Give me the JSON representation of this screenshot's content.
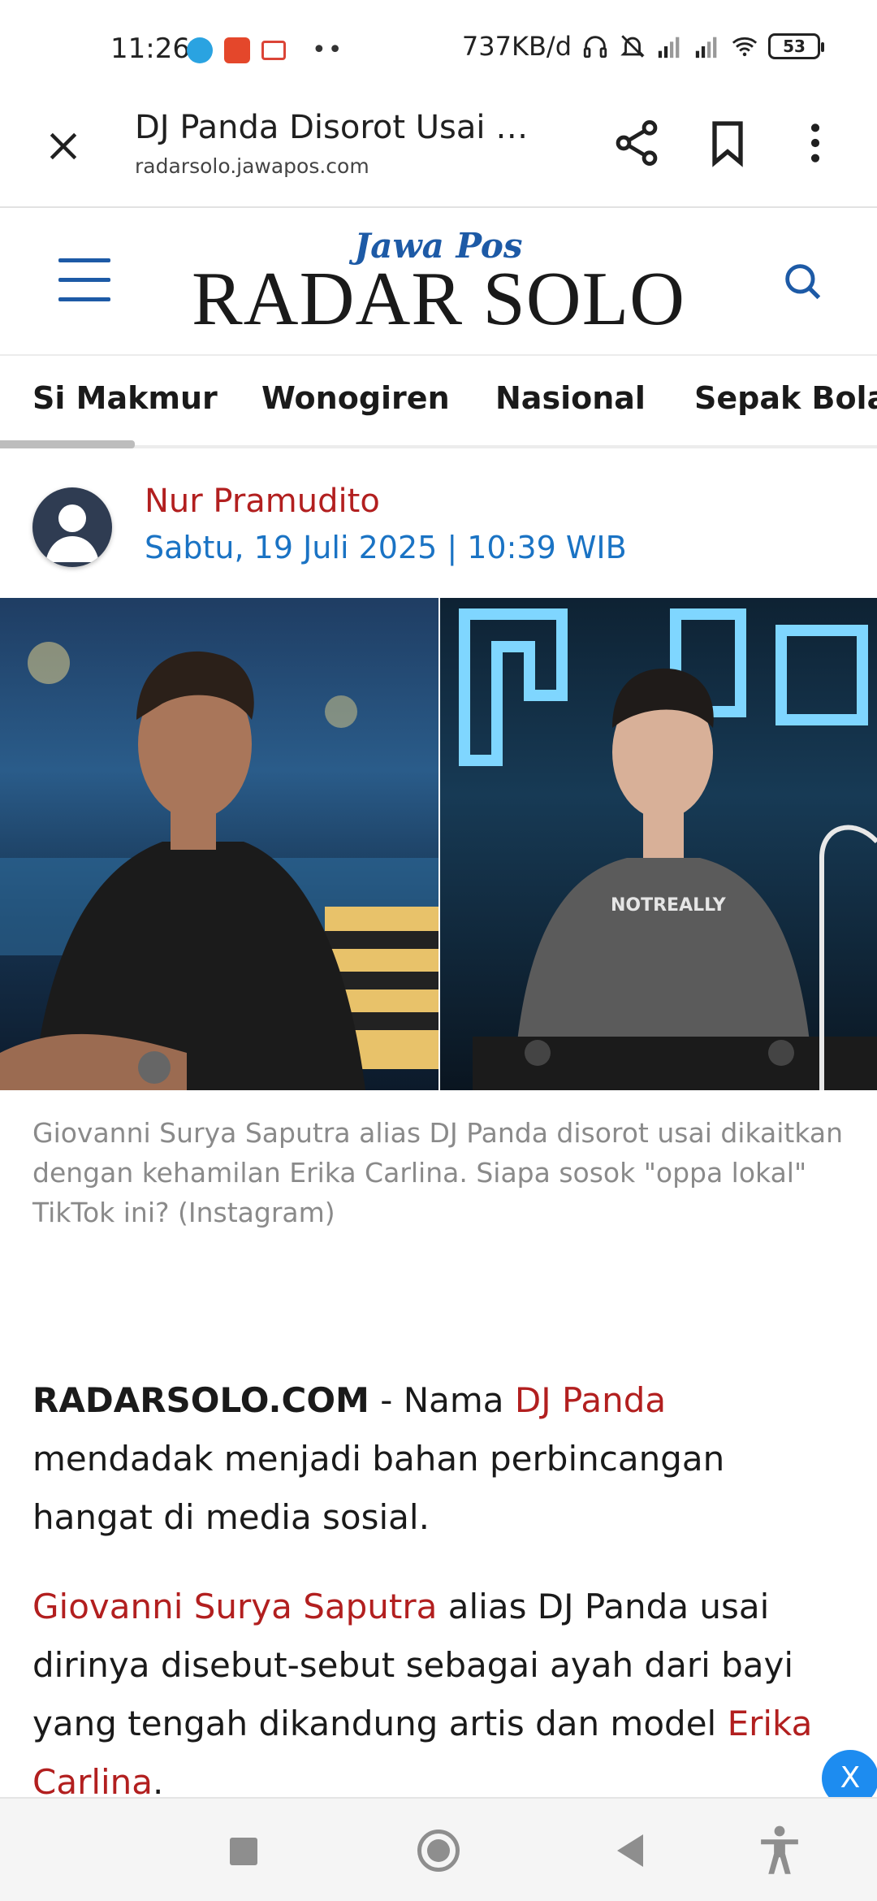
{
  "status_bar": {
    "time": "11:26",
    "data_rate": "737KB/d",
    "battery": "53"
  },
  "browser": {
    "title": "DJ Panda Disorot Usai …",
    "url": "radarsolo.jawapos.com"
  },
  "site": {
    "logo_top": "Jawa Pos",
    "logo_main": "RADAR SOLO"
  },
  "tabs": [
    "Si Makmur",
    "Wonogiren",
    "Nasional",
    "Sepak Bola"
  ],
  "author": {
    "name": "Nur Pramudito",
    "date": "Sabtu, 19 Juli 2025 | 10:39 WIB"
  },
  "image": {
    "caption": "Giovanni Surya Saputra alias DJ Panda disorot usai dikaitkan dengan kehamilan Erika Carlina. Siapa sosok \"oppa lokal\" TikTok ini? (Instagram)",
    "shirt_text": "NOTREALLY"
  },
  "article": {
    "p1_source": "RADARSOLO.COM",
    "p1_dash": " - Nama ",
    "p1_link": "DJ Panda",
    "p1_rest": " mendadak menjadi bahan perbincangan hangat di media sosial.",
    "p2_link": "Giovanni Surya Saputra",
    "p2_text": " alias DJ Panda  usai dirinya disebut-sebut sebagai ayah dari bayi yang tengah dikandung artis dan model ",
    "p2_link2": "Erika Carlina",
    "p2_end": "."
  },
  "floating_close": "X",
  "colors": {
    "brand_blue": "#1d5aa6",
    "author_red": "#b21f1f",
    "date_blue": "#1a73c4",
    "float_blue": "#1d8cf0"
  },
  "icons": [
    "close-icon",
    "share-icon",
    "bookmark-icon",
    "more-vert-icon",
    "menu-icon",
    "search-icon",
    "nav-recents-icon",
    "nav-home-icon",
    "nav-back-icon",
    "accessibility-icon"
  ]
}
